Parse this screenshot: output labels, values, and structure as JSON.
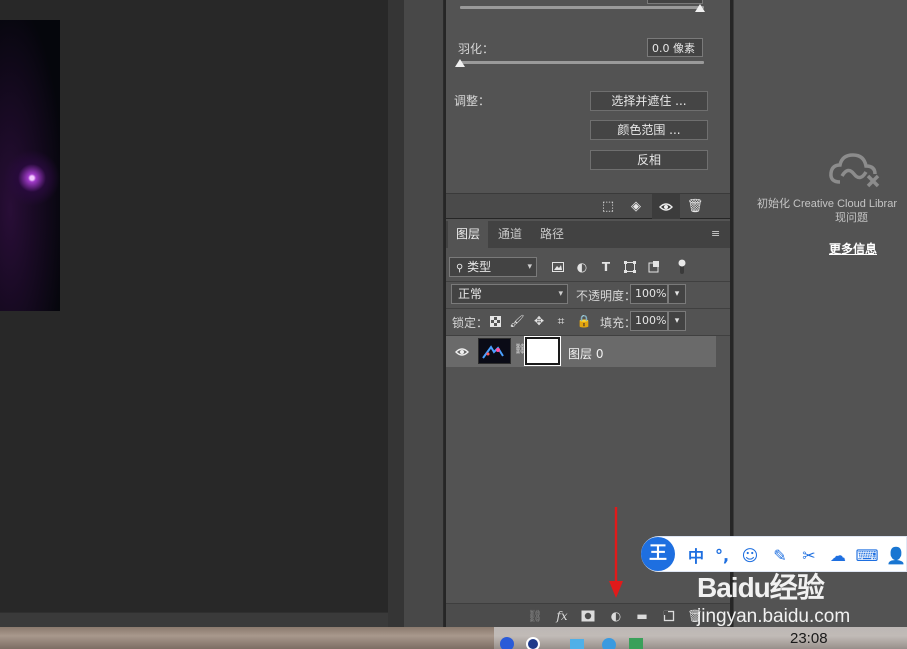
{
  "properties": {
    "feather_label": "羽化：",
    "feather_value": "0.0 像素",
    "adjust_label": "调整：",
    "select_mask_btn": "选择并遮住 ...",
    "color_range_btn": "颜色范围 ...",
    "invert_btn": "反相"
  },
  "layers": {
    "tabs": [
      "图层",
      "通道",
      "路径"
    ],
    "filter_label": "类型",
    "blend_mode": "正常",
    "opacity_label": "不透明度：",
    "opacity_value": "100%",
    "lock_label": "锁定：",
    "fill_label": "填充：",
    "fill_value": "100%",
    "layer_name": "图层 0"
  },
  "library": {
    "message_line1": "初始化 Creative Cloud Librar",
    "message_line2": "现问题",
    "more_info": "更多信息"
  },
  "ime": {
    "logo": "王",
    "mode_char": "中"
  },
  "watermark": {
    "brand": "Baidu经验",
    "url": "jingyan.baidu.com"
  },
  "taskbar": {
    "clock": "23:08"
  },
  "icons": {
    "arrow_color": "#e11a1a",
    "ime_color": "#1e6fe0",
    "accent": "#535353"
  }
}
